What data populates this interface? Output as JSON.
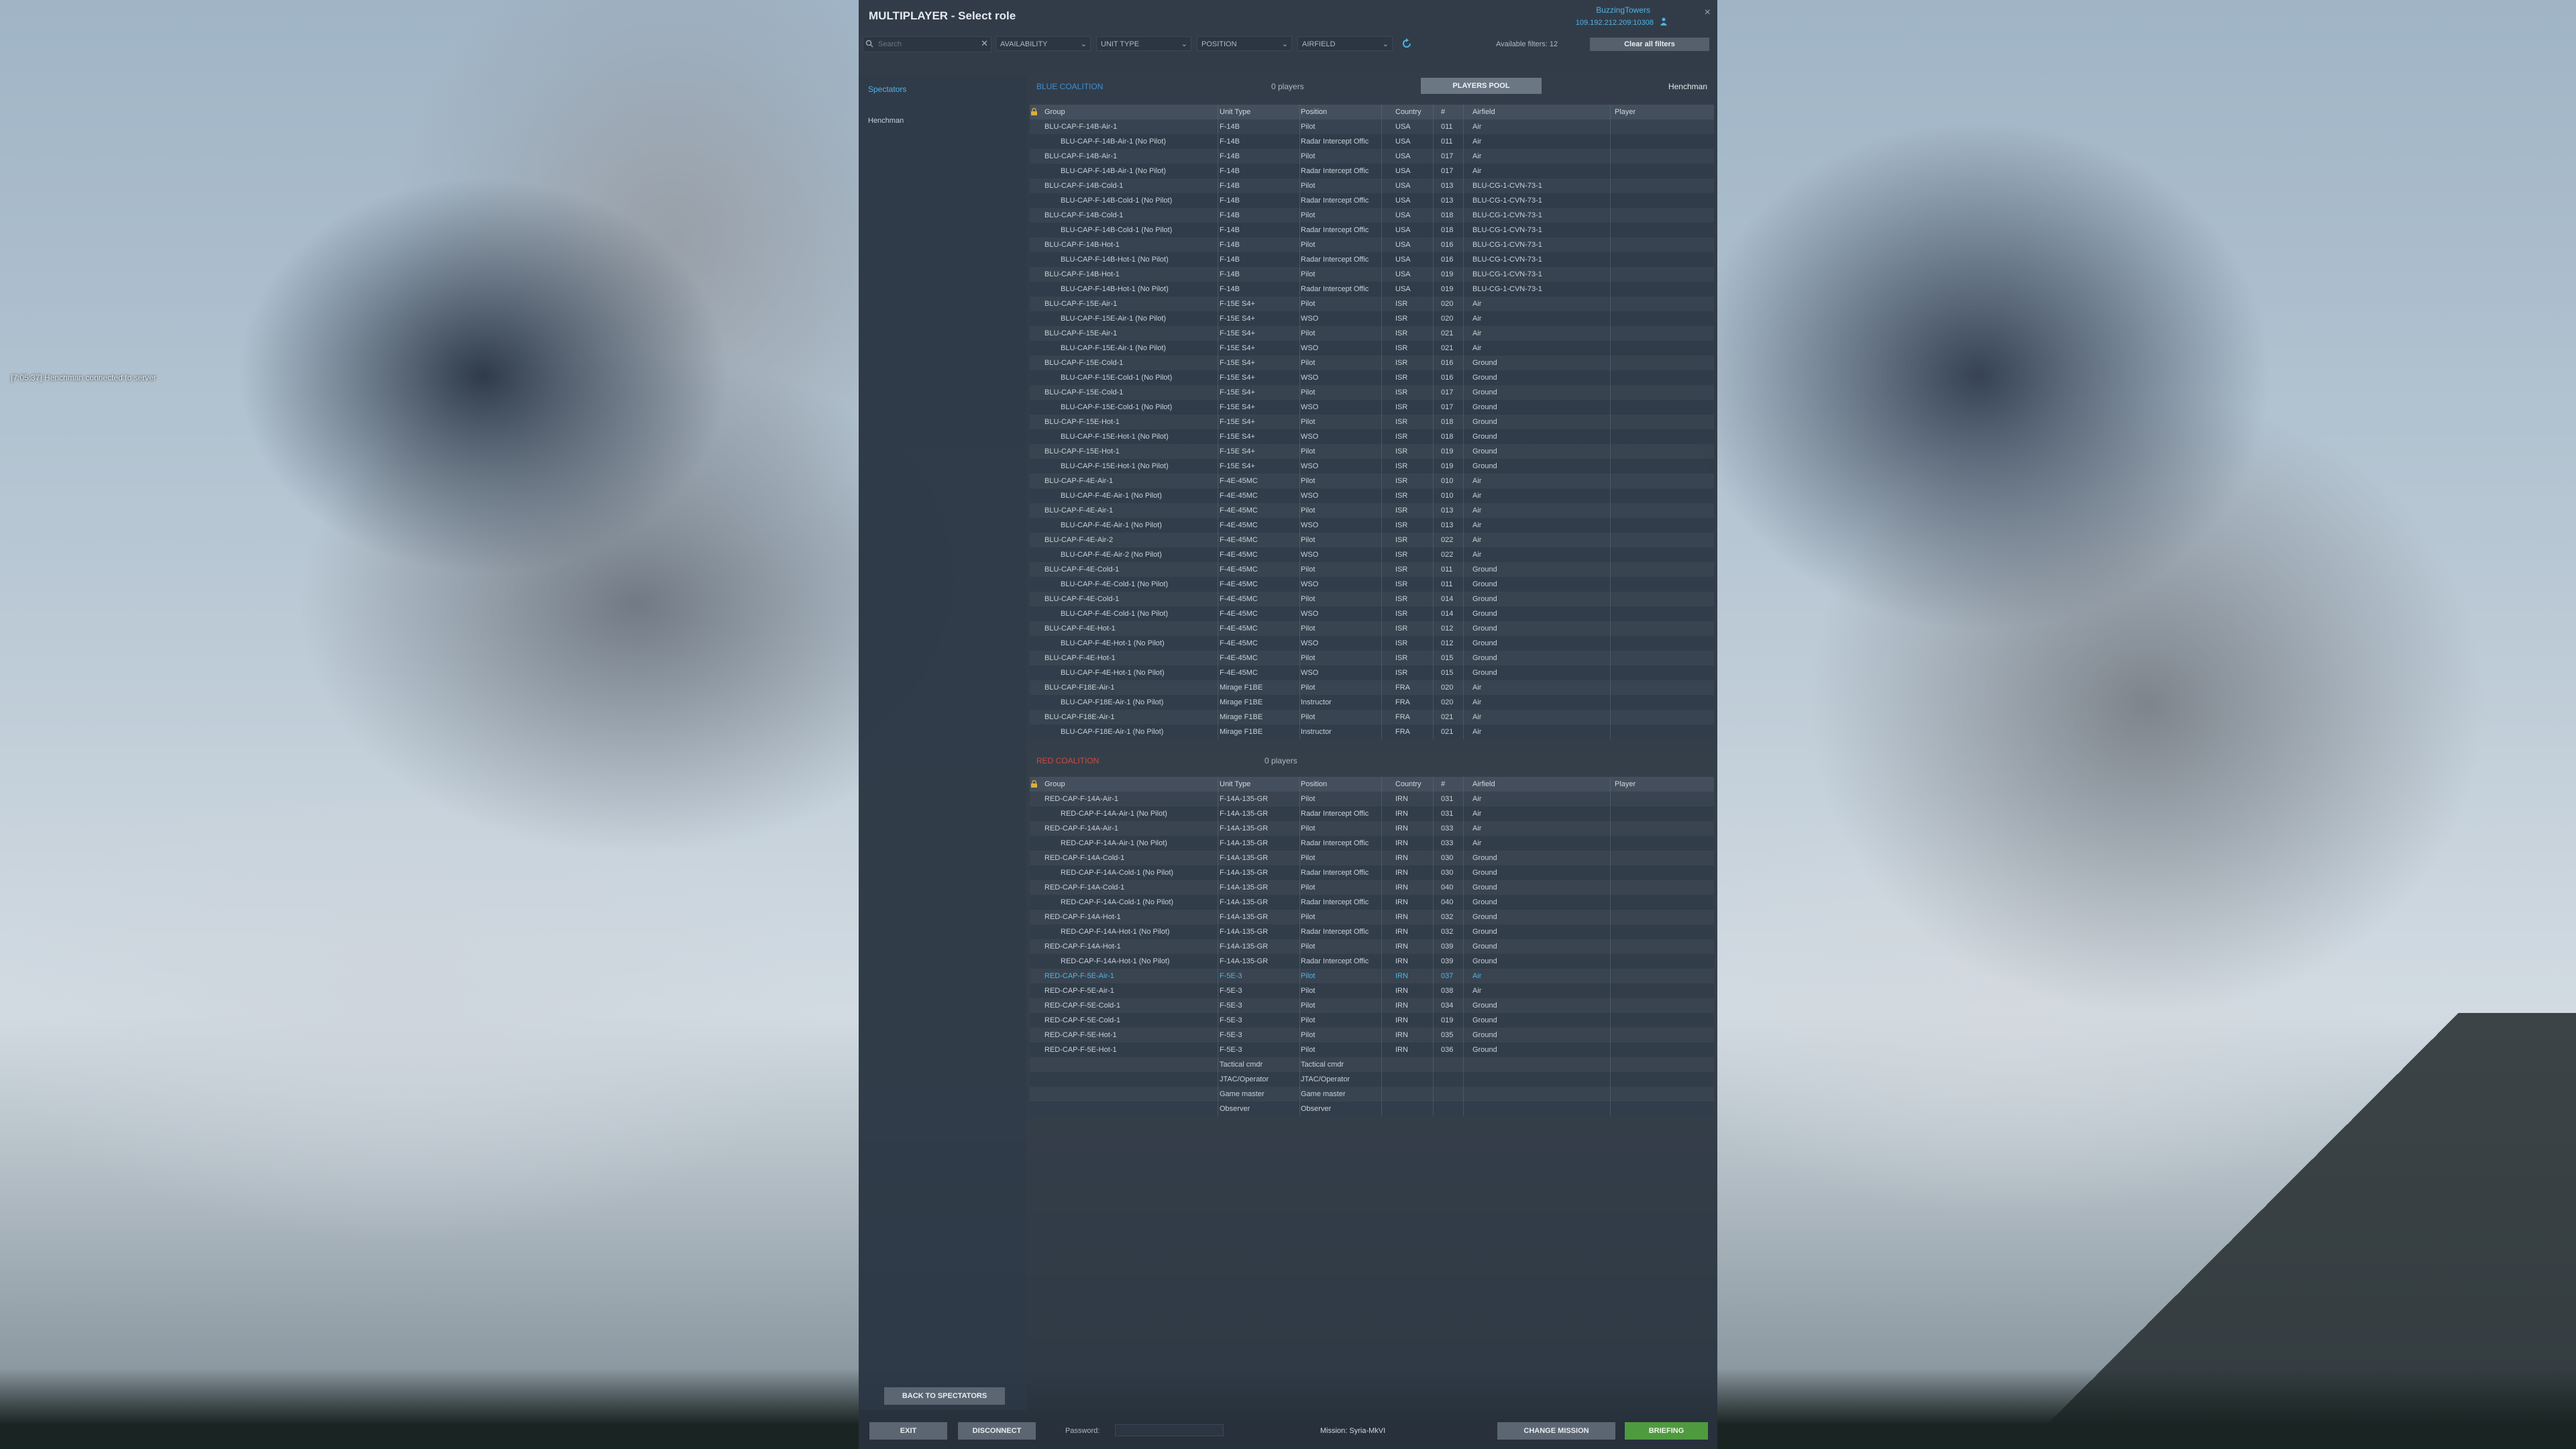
{
  "window": {
    "title": "MULTIPLAYER - Select role",
    "username": "BuzzingTowers",
    "ip": "109.192.212.209:10308",
    "close_icon": "×"
  },
  "chat": {
    "message": "[7:05:37] Henchman connected to server"
  },
  "filters": {
    "search_placeholder": "Search",
    "clear_icon": "✕",
    "availability": "AVAILABILITY",
    "unit_type": "UNIT TYPE",
    "position": "POSITION",
    "airfield": "AIRFIELD",
    "chevron": "⌄",
    "available": "Available filters: 12",
    "clear_all": "Clear all filters"
  },
  "sidebar": {
    "spectators": "Spectators",
    "player": "Henchman",
    "back_button": "BACK TO SPECTATORS"
  },
  "columns": {
    "group": "Group",
    "unit_type": "Unit Type",
    "position": "Position",
    "country": "Country",
    "num": "#",
    "airfield": "Airfield",
    "player": "Player"
  },
  "blue": {
    "title": "BLUE COALITION",
    "players": "0 players",
    "pool_button": "PLAYERS POOL",
    "current_player": "Henchman",
    "color": "#3f8fd0",
    "rows": [
      [
        "BLU-CAP-F-14B-Air-1",
        "F-14B",
        "Pilot",
        "USA",
        "011",
        "Air",
        ""
      ],
      [
        "BLU-CAP-F-14B-Air-1 (No Pilot)",
        "F-14B",
        "Radar Intercept Offic",
        "USA",
        "011",
        "Air",
        ""
      ],
      [
        "BLU-CAP-F-14B-Air-1",
        "F-14B",
        "Pilot",
        "USA",
        "017",
        "Air",
        ""
      ],
      [
        "BLU-CAP-F-14B-Air-1 (No Pilot)",
        "F-14B",
        "Radar Intercept Offic",
        "USA",
        "017",
        "Air",
        ""
      ],
      [
        "BLU-CAP-F-14B-Cold-1",
        "F-14B",
        "Pilot",
        "USA",
        "013",
        "BLU-CG-1-CVN-73-1",
        ""
      ],
      [
        "BLU-CAP-F-14B-Cold-1 (No Pilot)",
        "F-14B",
        "Radar Intercept Offic",
        "USA",
        "013",
        "BLU-CG-1-CVN-73-1",
        ""
      ],
      [
        "BLU-CAP-F-14B-Cold-1",
        "F-14B",
        "Pilot",
        "USA",
        "018",
        "BLU-CG-1-CVN-73-1",
        ""
      ],
      [
        "BLU-CAP-F-14B-Cold-1 (No Pilot)",
        "F-14B",
        "Radar Intercept Offic",
        "USA",
        "018",
        "BLU-CG-1-CVN-73-1",
        ""
      ],
      [
        "BLU-CAP-F-14B-Hot-1",
        "F-14B",
        "Pilot",
        "USA",
        "016",
        "BLU-CG-1-CVN-73-1",
        ""
      ],
      [
        "BLU-CAP-F-14B-Hot-1 (No Pilot)",
        "F-14B",
        "Radar Intercept Offic",
        "USA",
        "016",
        "BLU-CG-1-CVN-73-1",
        ""
      ],
      [
        "BLU-CAP-F-14B-Hot-1",
        "F-14B",
        "Pilot",
        "USA",
        "019",
        "BLU-CG-1-CVN-73-1",
        ""
      ],
      [
        "BLU-CAP-F-14B-Hot-1 (No Pilot)",
        "F-14B",
        "Radar Intercept Offic",
        "USA",
        "019",
        "BLU-CG-1-CVN-73-1",
        ""
      ],
      [
        "BLU-CAP-F-15E-Air-1",
        "F-15E S4+",
        "Pilot",
        "ISR",
        "020",
        "Air",
        ""
      ],
      [
        "BLU-CAP-F-15E-Air-1 (No Pilot)",
        "F-15E S4+",
        "WSO",
        "ISR",
        "020",
        "Air",
        ""
      ],
      [
        "BLU-CAP-F-15E-Air-1",
        "F-15E S4+",
        "Pilot",
        "ISR",
        "021",
        "Air",
        ""
      ],
      [
        "BLU-CAP-F-15E-Air-1 (No Pilot)",
        "F-15E S4+",
        "WSO",
        "ISR",
        "021",
        "Air",
        ""
      ],
      [
        "BLU-CAP-F-15E-Cold-1",
        "F-15E S4+",
        "Pilot",
        "ISR",
        "016",
        "Ground",
        ""
      ],
      [
        "BLU-CAP-F-15E-Cold-1 (No Pilot)",
        "F-15E S4+",
        "WSO",
        "ISR",
        "016",
        "Ground",
        ""
      ],
      [
        "BLU-CAP-F-15E-Cold-1",
        "F-15E S4+",
        "Pilot",
        "ISR",
        "017",
        "Ground",
        ""
      ],
      [
        "BLU-CAP-F-15E-Cold-1 (No Pilot)",
        "F-15E S4+",
        "WSO",
        "ISR",
        "017",
        "Ground",
        ""
      ],
      [
        "BLU-CAP-F-15E-Hot-1",
        "F-15E S4+",
        "Pilot",
        "ISR",
        "018",
        "Ground",
        ""
      ],
      [
        "BLU-CAP-F-15E-Hot-1 (No Pilot)",
        "F-15E S4+",
        "WSO",
        "ISR",
        "018",
        "Ground",
        ""
      ],
      [
        "BLU-CAP-F-15E-Hot-1",
        "F-15E S4+",
        "Pilot",
        "ISR",
        "019",
        "Ground",
        ""
      ],
      [
        "BLU-CAP-F-15E-Hot-1 (No Pilot)",
        "F-15E S4+",
        "WSO",
        "ISR",
        "019",
        "Ground",
        ""
      ],
      [
        "BLU-CAP-F-4E-Air-1",
        "F-4E-45MC",
        "Pilot",
        "ISR",
        "010",
        "Air",
        ""
      ],
      [
        "BLU-CAP-F-4E-Air-1 (No Pilot)",
        "F-4E-45MC",
        "WSO",
        "ISR",
        "010",
        "Air",
        ""
      ],
      [
        "BLU-CAP-F-4E-Air-1",
        "F-4E-45MC",
        "Pilot",
        "ISR",
        "013",
        "Air",
        ""
      ],
      [
        "BLU-CAP-F-4E-Air-1 (No Pilot)",
        "F-4E-45MC",
        "WSO",
        "ISR",
        "013",
        "Air",
        ""
      ],
      [
        "BLU-CAP-F-4E-Air-2",
        "F-4E-45MC",
        "Pilot",
        "ISR",
        "022",
        "Air",
        ""
      ],
      [
        "BLU-CAP-F-4E-Air-2 (No Pilot)",
        "F-4E-45MC",
        "WSO",
        "ISR",
        "022",
        "Air",
        ""
      ],
      [
        "BLU-CAP-F-4E-Cold-1",
        "F-4E-45MC",
        "Pilot",
        "ISR",
        "011",
        "Ground",
        ""
      ],
      [
        "BLU-CAP-F-4E-Cold-1 (No Pilot)",
        "F-4E-45MC",
        "WSO",
        "ISR",
        "011",
        "Ground",
        ""
      ],
      [
        "BLU-CAP-F-4E-Cold-1",
        "F-4E-45MC",
        "Pilot",
        "ISR",
        "014",
        "Ground",
        ""
      ],
      [
        "BLU-CAP-F-4E-Cold-1 (No Pilot)",
        "F-4E-45MC",
        "WSO",
        "ISR",
        "014",
        "Ground",
        ""
      ],
      [
        "BLU-CAP-F-4E-Hot-1",
        "F-4E-45MC",
        "Pilot",
        "ISR",
        "012",
        "Ground",
        ""
      ],
      [
        "BLU-CAP-F-4E-Hot-1 (No Pilot)",
        "F-4E-45MC",
        "WSO",
        "ISR",
        "012",
        "Ground",
        ""
      ],
      [
        "BLU-CAP-F-4E-Hot-1",
        "F-4E-45MC",
        "Pilot",
        "ISR",
        "015",
        "Ground",
        ""
      ],
      [
        "BLU-CAP-F-4E-Hot-1 (No Pilot)",
        "F-4E-45MC",
        "WSO",
        "ISR",
        "015",
        "Ground",
        ""
      ],
      [
        "BLU-CAP-F18E-Air-1",
        "Mirage F1BE",
        "Pilot",
        "FRA",
        "020",
        "Air",
        ""
      ],
      [
        "BLU-CAP-F18E-Air-1 (No Pilot)",
        "Mirage F1BE",
        "Instructor",
        "FRA",
        "020",
        "Air",
        ""
      ],
      [
        "BLU-CAP-F18E-Air-1",
        "Mirage F1BE",
        "Pilot",
        "FRA",
        "021",
        "Air",
        ""
      ],
      [
        "BLU-CAP-F18E-Air-1 (No Pilot)",
        "Mirage F1BE",
        "Instructor",
        "FRA",
        "021",
        "Air",
        ""
      ]
    ]
  },
  "red": {
    "title": "RED COALITION",
    "players": "0 players",
    "color": "#d0483f",
    "rows": [
      [
        "RED-CAP-F-14A-Air-1",
        "F-14A-135-GR",
        "Pilot",
        "IRN",
        "031",
        "Air",
        ""
      ],
      [
        "RED-CAP-F-14A-Air-1 (No Pilot)",
        "F-14A-135-GR",
        "Radar Intercept Offic",
        "IRN",
        "031",
        "Air",
        ""
      ],
      [
        "RED-CAP-F-14A-Air-1",
        "F-14A-135-GR",
        "Pilot",
        "IRN",
        "033",
        "Air",
        ""
      ],
      [
        "RED-CAP-F-14A-Air-1 (No Pilot)",
        "F-14A-135-GR",
        "Radar Intercept Offic",
        "IRN",
        "033",
        "Air",
        ""
      ],
      [
        "RED-CAP-F-14A-Cold-1",
        "F-14A-135-GR",
        "Pilot",
        "IRN",
        "030",
        "Ground",
        ""
      ],
      [
        "RED-CAP-F-14A-Cold-1 (No Pilot)",
        "F-14A-135-GR",
        "Radar Intercept Offic",
        "IRN",
        "030",
        "Ground",
        ""
      ],
      [
        "RED-CAP-F-14A-Cold-1",
        "F-14A-135-GR",
        "Pilot",
        "IRN",
        "040",
        "Ground",
        ""
      ],
      [
        "RED-CAP-F-14A-Cold-1 (No Pilot)",
        "F-14A-135-GR",
        "Radar Intercept Offic",
        "IRN",
        "040",
        "Ground",
        ""
      ],
      [
        "RED-CAP-F-14A-Hot-1",
        "F-14A-135-GR",
        "Pilot",
        "IRN",
        "032",
        "Ground",
        ""
      ],
      [
        "RED-CAP-F-14A-Hot-1 (No Pilot)",
        "F-14A-135-GR",
        "Radar Intercept Offic",
        "IRN",
        "032",
        "Ground",
        ""
      ],
      [
        "RED-CAP-F-14A-Hot-1",
        "F-14A-135-GR",
        "Pilot",
        "IRN",
        "039",
        "Ground",
        ""
      ],
      [
        "RED-CAP-F-14A-Hot-1 (No Pilot)",
        "F-14A-135-GR",
        "Radar Intercept Offic",
        "IRN",
        "039",
        "Ground",
        ""
      ],
      [
        "RED-CAP-F-5E-Air-1",
        "F-5E-3",
        "Pilot",
        "IRN",
        "037",
        "Air",
        ""
      ],
      [
        "RED-CAP-F-5E-Air-1",
        "F-5E-3",
        "Pilot",
        "IRN",
        "038",
        "Air",
        ""
      ],
      [
        "RED-CAP-F-5E-Cold-1",
        "F-5E-3",
        "Pilot",
        "IRN",
        "034",
        "Ground",
        ""
      ],
      [
        "RED-CAP-F-5E-Cold-1",
        "F-5E-3",
        "Pilot",
        "IRN",
        "019",
        "Ground",
        ""
      ],
      [
        "RED-CAP-F-5E-Hot-1",
        "F-5E-3",
        "Pilot",
        "IRN",
        "035",
        "Ground",
        ""
      ],
      [
        "RED-CAP-F-5E-Hot-1",
        "F-5E-3",
        "Pilot",
        "IRN",
        "036",
        "Ground",
        ""
      ],
      [
        "",
        "Tactical cmdr",
        "Tactical cmdr",
        "",
        "",
        "",
        ""
      ],
      [
        "",
        "JTAC/Operator",
        "JTAC/Operator",
        "",
        "",
        "",
        ""
      ],
      [
        "",
        "Game master",
        "Game master",
        "",
        "",
        "",
        ""
      ],
      [
        "",
        "Observer",
        "Observer",
        "",
        "",
        "",
        ""
      ]
    ],
    "highlight_row": 12,
    "highlight_color": "#4fb4e6"
  },
  "bottom": {
    "exit": "EXIT",
    "disconnect": "DISCONNECT",
    "password_label": "Password:",
    "mission": "Mission: Syria-MkVI",
    "change_mission": "CHANGE MISSION",
    "briefing": "BRIEFING"
  }
}
